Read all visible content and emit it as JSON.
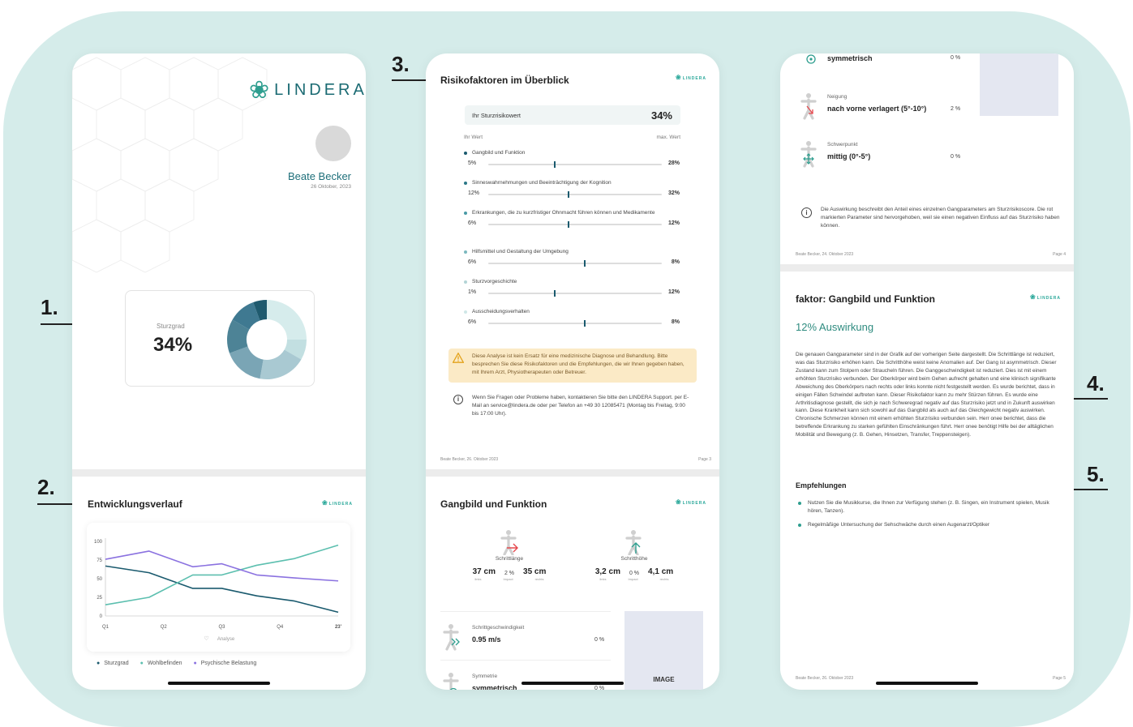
{
  "annotations": [
    "1.",
    "2.",
    "3.",
    "4.",
    "5."
  ],
  "brand": {
    "name": "LINDERA",
    "small_name": "LINDERA"
  },
  "colors": {
    "background": "#d5ecea",
    "teal_dark": "#1a5a6e",
    "teal_light": "#5cbfaf",
    "purple": "#8b72e0",
    "brand": "#1b6b73"
  },
  "screen1": {
    "user_name": "Beate Becker",
    "date": "26 Oktober, 2023",
    "score_label": "Sturzgrad",
    "score_value": "34%",
    "dev_title": "Entwicklungsverlauf"
  },
  "chart_data": {
    "type": "line",
    "title": "",
    "xlabel": "Analyse",
    "ylabel": "",
    "categories": [
      "Q1",
      "Q2",
      "Q3",
      "Q4",
      "23'"
    ],
    "ylim": [
      0,
      100
    ],
    "yticks": [
      0,
      25,
      50,
      75,
      100
    ],
    "x": [
      0,
      0.75,
      1.5,
      2,
      2.6,
      3.25,
      4
    ],
    "series": [
      {
        "name": "Sturzgrad",
        "color": "#1a5a6e",
        "values": [
          67,
          58,
          37,
          37,
          27,
          20,
          5
        ]
      },
      {
        "name": "Wohlbefinden",
        "color": "#5cbfaf",
        "values": [
          15,
          25,
          55,
          55,
          68,
          77,
          95
        ]
      },
      {
        "name": "Psychische Belastung",
        "color": "#8b72e0",
        "values": [
          76,
          87,
          66,
          70,
          55,
          51,
          47
        ]
      }
    ],
    "grid": false,
    "legend": "bottom"
  },
  "screen2": {
    "title": "Risikofaktoren im Überblick",
    "risk_label": "Ihr Sturzrisikowert",
    "risk_value": "34%",
    "col_left": "Ihr Wert",
    "col_right": "max. Wert",
    "factors": [
      {
        "label": "Gangbild und Funktion",
        "low": "5%",
        "high": "28%",
        "marker": 0.38,
        "dot": "#1a5a6e"
      },
      {
        "label": "Sinneswahrnehmungen und Beeinträchtigung der Kognition",
        "low": "12%",
        "high": "32%",
        "marker": 0.46,
        "dot": "#2a7787"
      },
      {
        "label": "Erkrankungen, die zu kurzfristiger Ohnmacht führen können und Medikamente",
        "low": "6%",
        "high": "12%",
        "marker": 0.46,
        "dot": "#4a9aa6"
      },
      {
        "label": "Hilfsmittel und Gestaltung der Umgebung",
        "low": "6%",
        "high": "8%",
        "marker": 0.55,
        "dot": "#7bb8be"
      },
      {
        "label": "Sturzvorgeschichte",
        "low": "1%",
        "high": "12%",
        "marker": 0.38,
        "dot": "#b3d4d6"
      },
      {
        "label": "Ausscheidungsverhalten",
        "low": "6%",
        "high": "8%",
        "marker": 0.55,
        "dot": "#cfe7e7"
      }
    ],
    "warning": "Diese Analyse ist kein Ersatz für eine medizinische Diagnose und Behandlung. Bitte besprechen Sie diese Risikofaktoren und die Empfehlungen, die wir Ihnen gegeben haben, mit Ihrem Arzt, Physiotherapeuten oder Betreuer.",
    "contact": "Wenn Sie Fragen oder Probleme haben, kontaktieren Sie bitte den LINDERA Support. per E-Mail an service@lindera.de oder per Telefon an +49 30 12085471 (Montag bis Freitag, 9:00 bis 17:00 Uhr).",
    "footer_left": "Beate Becker, 26. Oktober 2023",
    "footer_right": "Page 3",
    "gait_title": "Gangbild und Funktion",
    "step_length": {
      "label": "Schrittlänge",
      "left": "37 cm",
      "pct": "2 %",
      "right": "35 cm",
      "sub_left": "links",
      "sub_mid": "Impact",
      "sub_right": "rechts"
    },
    "step_height": {
      "label": "Schritthöhe",
      "left": "3,2 cm",
      "pct": "0 %",
      "right": "4,1 cm",
      "sub_left": "links",
      "sub_mid": "Impact",
      "sub_right": "rechts"
    },
    "speed": {
      "label": "Schrittgeschwindigkeit",
      "value": "0.95 m/s",
      "pct": "0 %"
    },
    "symmetry": {
      "label": "Symmetrie",
      "value": "symmetrisch",
      "pct": "0 %"
    },
    "image_label": "IMAGE"
  },
  "screen3": {
    "symmetry_value": "symmetrisch",
    "symmetry_pct": "0 %",
    "tilt_label": "Neigung",
    "tilt_value": "nach vorne verlagert (5°-10°)",
    "tilt_pct": "2 %",
    "center_label": "Schwerpunkt",
    "center_value": "mittig (0°-5°)",
    "center_pct": "0 %",
    "description": "Die Auswirkung beschreibt den Anteil eines einzelnen Gangparameters am Sturzrisikoscore. Die rot markierten Parameter sind hervorgehoben, weil sie einen negativen Einfluss auf das Sturzrisiko haben können.",
    "footer_left": "Beate Becker, 24. Oktober 2023",
    "footer_right": "Page 4",
    "factor_title": "faktor: Gangbild und Funktion",
    "impact": "12% Auswirkung",
    "body": "Die genauen Gangparameter sind in der Grafik auf der vorherigen Seite dargestellt. Die Schrittlänge ist reduziert, was das Sturzrisiko erhöhen kann. Die Schritthöhe weist keine Anomalien auf. Der Gang ist asymmetrisch. Dieser Zustand kann zum Stolpern oder Straucheln führen. Die Ganggeschwindigkeit ist reduziert. Dies ist mit einem erhöhten Sturzrisiko verbunden. Der Oberkörper wird beim Gehen aufrecht gehalten und eine klinisch signifikante Abweichung des Oberkörpers nach rechts oder links konnte nicht festgestellt werden. Es wurde berichtet, dass in einigen Fällen Schwindel auftreten kann. Dieser Risikofaktor kann zu mehr Stürzen führen. Es wurde eine Arthritisdiagnose gestellt, die sich je nach Schweregrad negativ auf das Sturzrisiko jetzt und in Zukunft auswirken kann. Diese Krankheit kann sich sowohl auf das Gangbild als auch auf das Gleichgewicht negativ auswirken. Chronische Schmerzen können mit einem erhöhten Sturzrisiko verbunden sein. Herr onee berichtet, dass die betreffende Erkrankung zu starken gefühlten Einschränkungen führt. Herr onee benötigt Hilfe bei der alltäglichen Mobilität und Bewegung (z. B. Gehen, Hinsetzen, Transfer, Treppensteigen).",
    "rec_title": "Empfehlungen",
    "recommendations": [
      "Nutzen Sie die Musikkurse, die Ihnen zur Verfügung stehen (z. B. Singen, ein Instrument spielen, Musik hören, Tanzen).",
      "Regelmäßige Untersuchung der Sehschwäche durch einen Augenarzt/Optiker"
    ],
    "footer2_left": "Beate Becker, 26. Oktober 2023",
    "footer2_right": "Page 5"
  }
}
